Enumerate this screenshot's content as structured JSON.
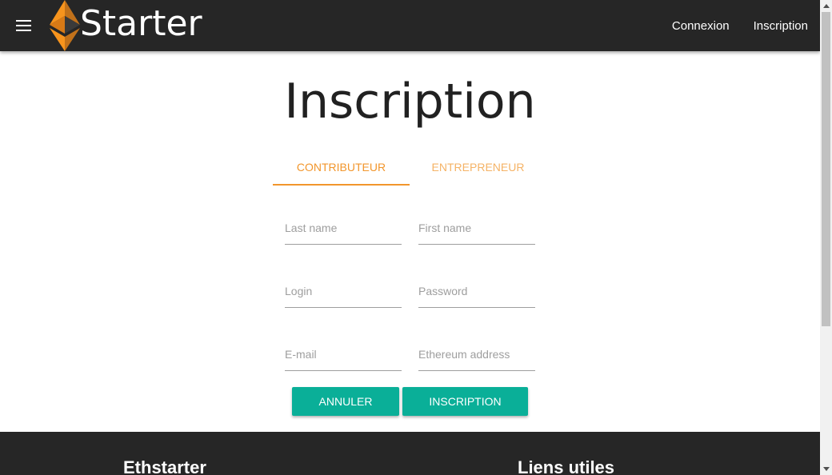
{
  "header": {
    "brand_text": "Starter",
    "logo_icon": "ethereum-diamond-icon",
    "menu_icon": "hamburger-menu-icon",
    "nav": [
      {
        "label": "Connexion"
      },
      {
        "label": "Inscription"
      }
    ]
  },
  "main": {
    "title": "Inscription",
    "tabs": [
      {
        "label": "CONTRIBUTEUR",
        "active": true
      },
      {
        "label": "ENTREPRENEUR",
        "active": false
      }
    ],
    "fields": {
      "last_name": {
        "placeholder": "Last name",
        "value": ""
      },
      "first_name": {
        "placeholder": "First name",
        "value": ""
      },
      "login": {
        "placeholder": "Login",
        "value": ""
      },
      "password": {
        "placeholder": "Password",
        "value": ""
      },
      "email": {
        "placeholder": "E-mail",
        "value": ""
      },
      "ethereum": {
        "placeholder": "Ethereum address",
        "value": ""
      }
    },
    "buttons": {
      "cancel_label": "ANNULER",
      "submit_label": "INSCRIPTION"
    }
  },
  "footer": {
    "col1_heading": "Ethstarter",
    "col2_heading": "Liens utiles"
  },
  "colors": {
    "topbar": "#262626",
    "accent_orange": "#f2962c",
    "button_teal": "#0aaf98",
    "footer": "#262626"
  }
}
